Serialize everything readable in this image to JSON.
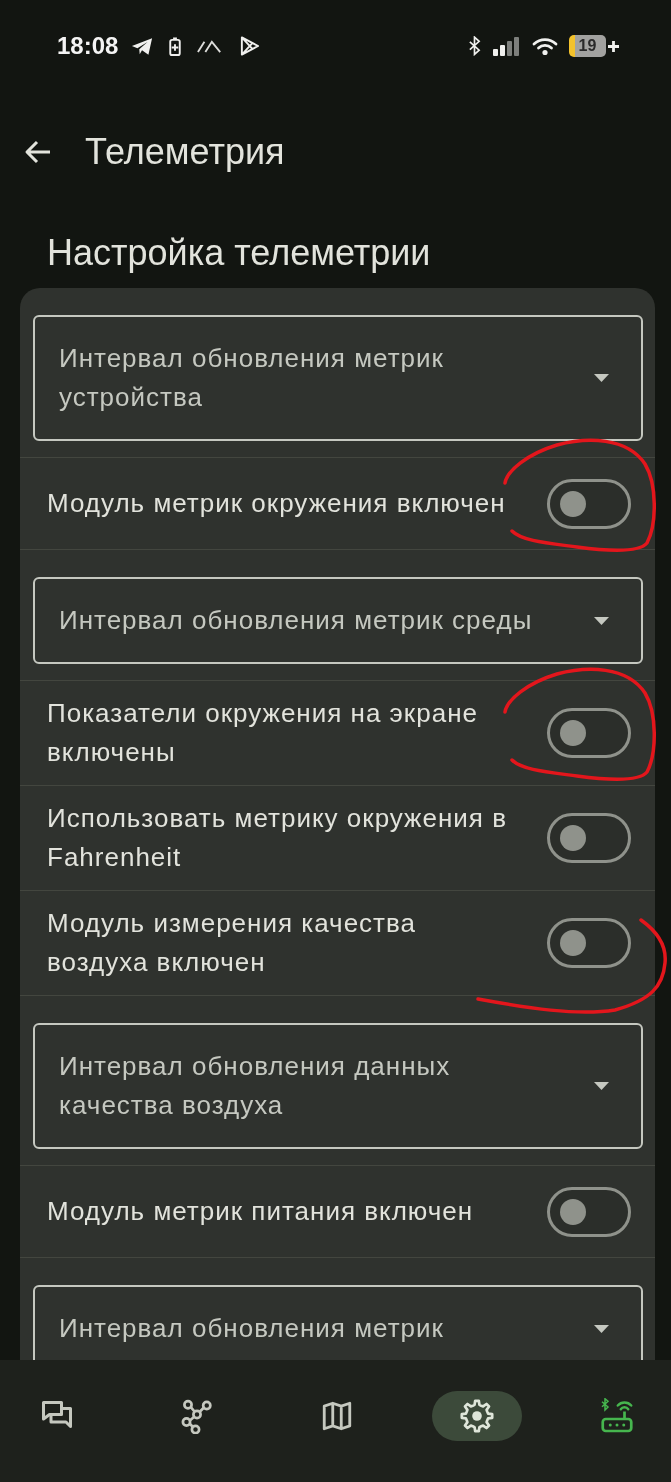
{
  "status_bar": {
    "time": "18:08",
    "battery": "19"
  },
  "app_bar": {
    "title": "Телеметрия"
  },
  "section": {
    "title": "Настройка телеметрии"
  },
  "settings": [
    {
      "kind": "dropdown",
      "label": "Интервал обновления метрик устройства"
    },
    {
      "kind": "toggle",
      "label": "Модуль метрик окружения включен",
      "on": false,
      "annotation": {
        "kind": "loop"
      }
    },
    {
      "kind": "dropdown",
      "label": "Интервал обновления метрик среды"
    },
    {
      "kind": "toggle",
      "label": "Показатели окружения на экране включены",
      "on": false,
      "annotation": {
        "kind": "loop"
      }
    },
    {
      "kind": "toggle",
      "label": "Использовать метрику окружения в Fahrenheit",
      "on": false
    },
    {
      "kind": "toggle",
      "label": "Модуль измерения качества воздуха включен",
      "on": false,
      "annotation": {
        "kind": "arc"
      }
    },
    {
      "kind": "dropdown",
      "label": "Интервал обновления данных качества воздуха"
    },
    {
      "kind": "toggle",
      "label": "Модуль метрик питания включен",
      "on": false
    },
    {
      "kind": "dropdown",
      "label": "Интервал обновления метрик"
    }
  ],
  "bottom_nav": {
    "items": [
      {
        "selected": false
      },
      {
        "selected": false
      },
      {
        "selected": false
      },
      {
        "selected": true
      },
      {
        "selected": false
      }
    ],
    "device_connected": true
  }
}
